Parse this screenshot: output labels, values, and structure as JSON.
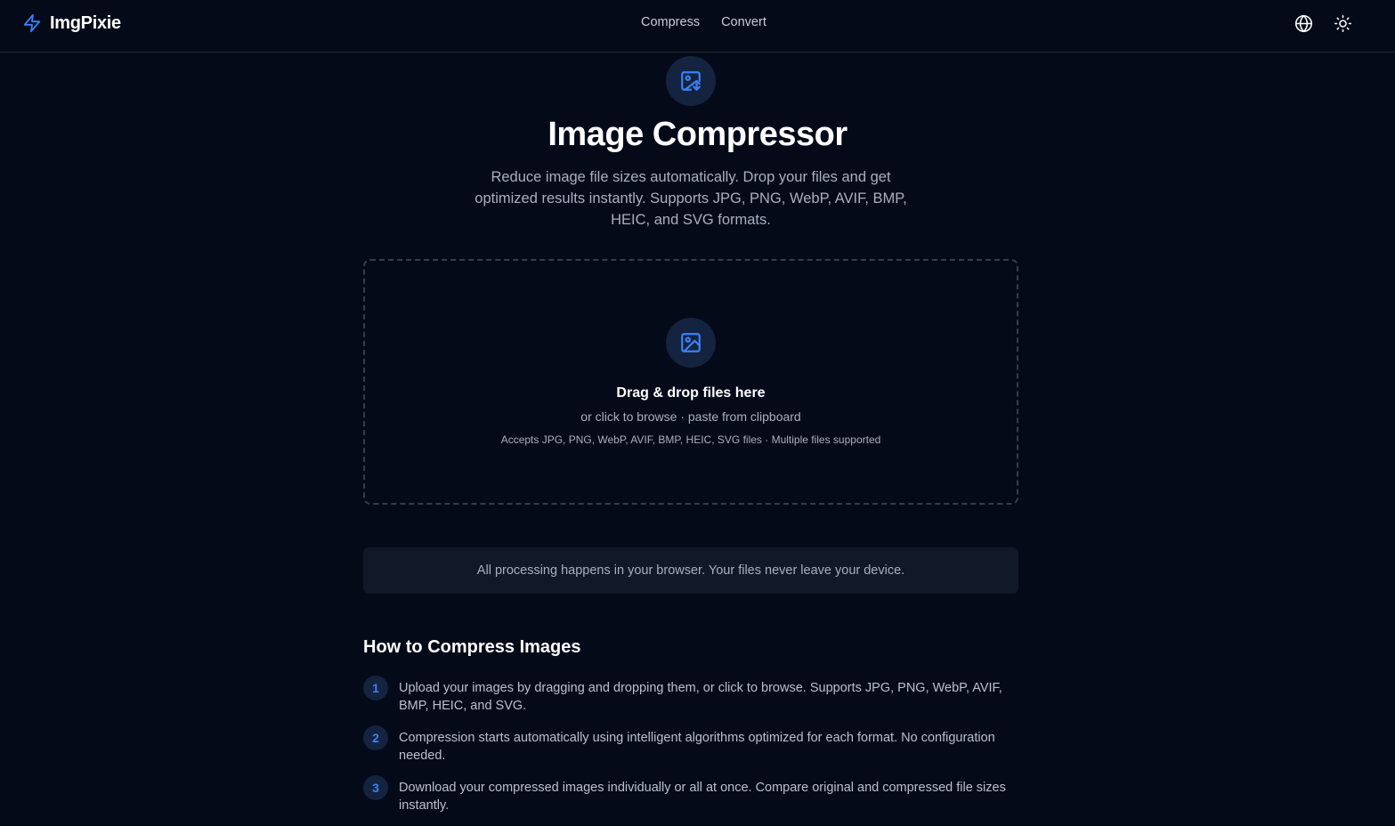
{
  "app": {
    "name": "ImgPixie"
  },
  "nav": {
    "items": [
      {
        "label": "Compress"
      },
      {
        "label": "Convert"
      }
    ]
  },
  "header": {
    "language_icon": "globe-icon",
    "theme_icon": "sun-icon"
  },
  "hero": {
    "icon": "image-download-icon",
    "title": "Image Compressor",
    "subtitle": "Reduce image file sizes automatically. Drop your files and get optimized results instantly. Supports JPG, PNG, WebP, AVIF, BMP, HEIC, and SVG formats."
  },
  "dropzone": {
    "icon": "image-icon",
    "title": "Drag & drop files here",
    "subtitle": "or click to browse · paste from clipboard",
    "accepts": "Accepts JPG, PNG, WebP, AVIF, BMP, HEIC, SVG files · Multiple files supported"
  },
  "privacy": {
    "text": "All processing happens in your browser. Your files never leave your device."
  },
  "howto": {
    "title": "How to Compress Images",
    "steps": [
      {
        "num": "1",
        "text": "Upload your images by dragging and dropping them, or click to browse. Supports JPG, PNG, WebP, AVIF, BMP, HEIC, and SVG."
      },
      {
        "num": "2",
        "text": "Compression starts automatically using intelligent algorithms optimized for each format. No configuration needed."
      },
      {
        "num": "3",
        "text": "Download your compressed images individually or all at once. Compare original and compressed file sizes instantly."
      }
    ]
  },
  "colors": {
    "background": "#050a19",
    "accent": "#3b82f6",
    "card": "#111827",
    "icon_circle": "#14233f"
  }
}
